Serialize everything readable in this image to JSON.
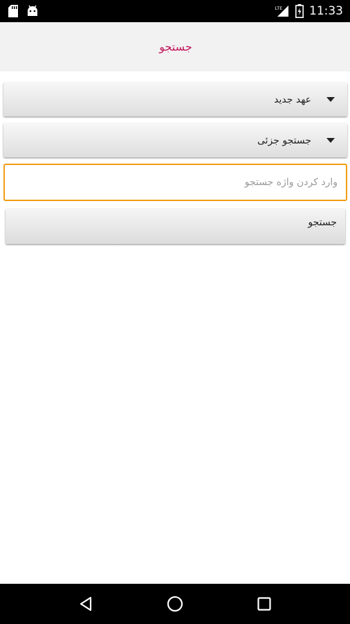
{
  "status_bar": {
    "time": "11:33",
    "network_label": "LTE",
    "icons": [
      "sd-card-icon",
      "android-icon",
      "signal-icon",
      "battery-icon"
    ]
  },
  "header": {
    "title": "جستجو"
  },
  "form": {
    "testament_select": {
      "selected": "عهد جدید"
    },
    "search_type_select": {
      "selected": "جستجو جزئی"
    },
    "query_input": {
      "placeholder": "وارد کردن واژه جستجو",
      "value": ""
    },
    "submit_label": "جستجو"
  },
  "nav_bar": {
    "items": [
      "back-icon",
      "home-icon",
      "recents-icon"
    ]
  },
  "colors": {
    "title": "#c2185b",
    "input_focus_border": "#f39c12",
    "header_bg": "#f2f2f2"
  }
}
